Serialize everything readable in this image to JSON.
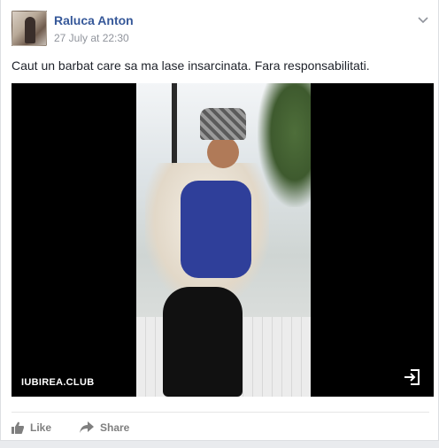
{
  "post": {
    "author": "Raluca Anton",
    "timestamp": "27 July at 22:30",
    "text": "Caut un barbat care sa ma lase insarcinata. Fara responsabilitati.",
    "media": {
      "watermark": "IUBIREA.CLUB",
      "expand_icon": "exit-to-app-icon"
    },
    "actions": {
      "like_label": "Like",
      "share_label": "Share"
    },
    "options_icon": "chevron-down-icon"
  },
  "colors": {
    "author_link": "#365899",
    "meta_text": "#90949c",
    "action_text": "#7f7f7f",
    "media_background": "#000000"
  }
}
